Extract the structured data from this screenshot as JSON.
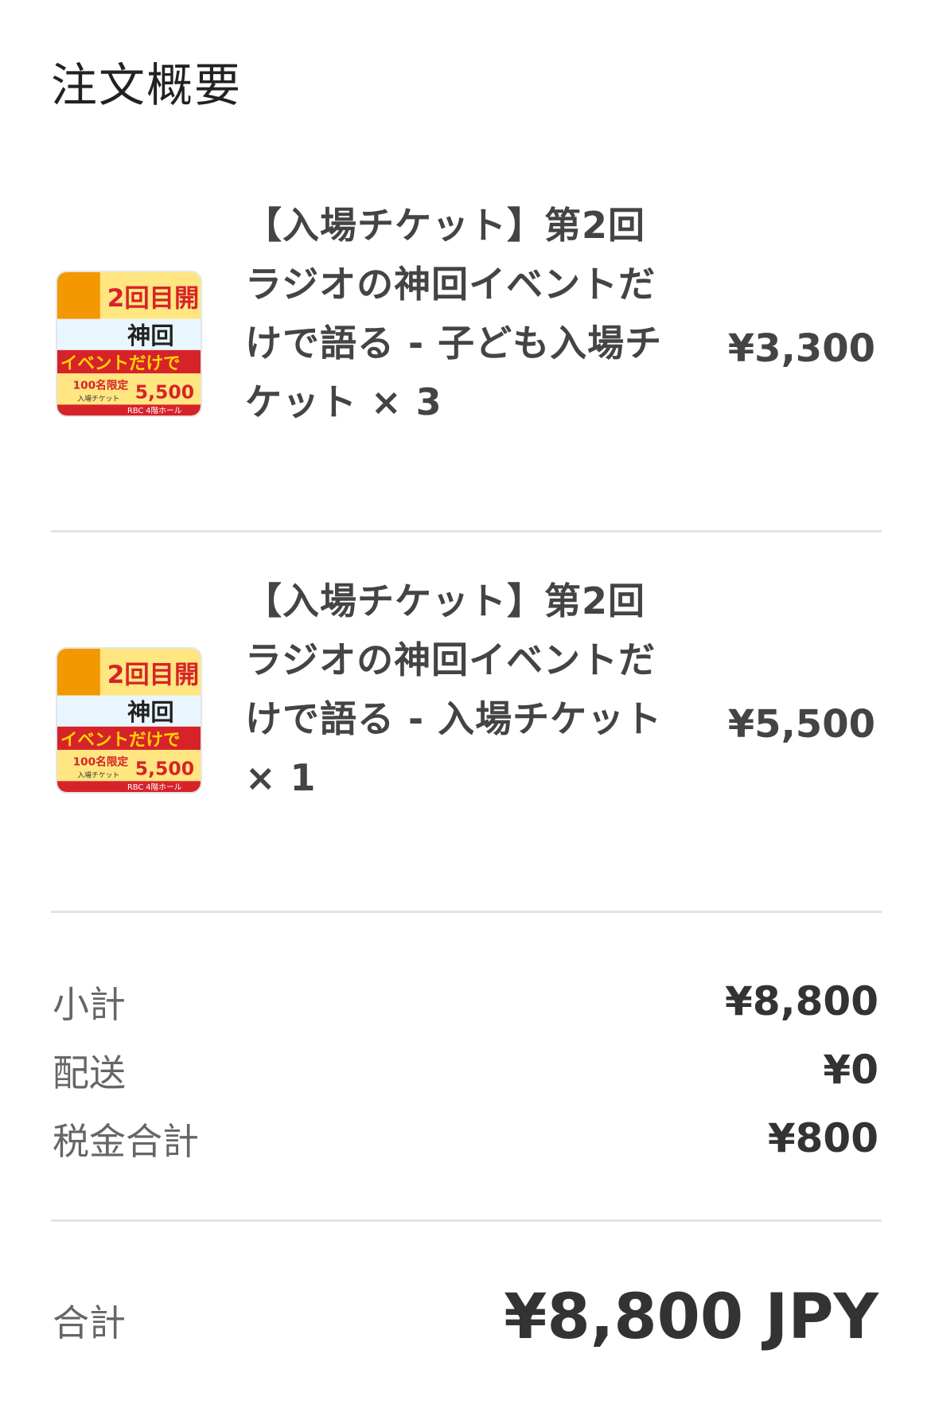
{
  "header": {
    "title": "注文概要"
  },
  "items": [
    {
      "name": "【入場チケット】第2回ラジオの神回イベントだけで語る - 子ども入場チケット × 3",
      "price": "¥3,300",
      "thumbnail": {
        "top_text": "2回目開",
        "mid_text": "神回",
        "banner_text": "イベントだけで",
        "limit_text": "100名限定",
        "ticket_text": "入場チケット",
        "price_text": "5,500",
        "venue_text": "RBC 4階ホール"
      }
    },
    {
      "name": "【入場チケット】第2回ラジオの神回イベントだけで語る - 入場チケット × 1",
      "price": "¥5,500",
      "thumbnail": {
        "top_text": "2回目開",
        "mid_text": "神回",
        "banner_text": "イベントだけで",
        "limit_text": "100名限定",
        "ticket_text": "入場チケット",
        "price_text": "5,500",
        "venue_text": "RBC 4階ホール"
      }
    }
  ],
  "summary": {
    "subtotal_label": "小計",
    "subtotal_value": "¥8,800",
    "shipping_label": "配送",
    "shipping_value": "¥0",
    "tax_label": "税金合計",
    "tax_value": "¥800"
  },
  "total": {
    "label": "合計",
    "value": "¥8,800 JPY"
  },
  "colors": {
    "brand_red": "#d6232a",
    "brand_yellow": "#ffd400",
    "brand_orange": "#f39800",
    "divider": "#e3e3e3"
  }
}
